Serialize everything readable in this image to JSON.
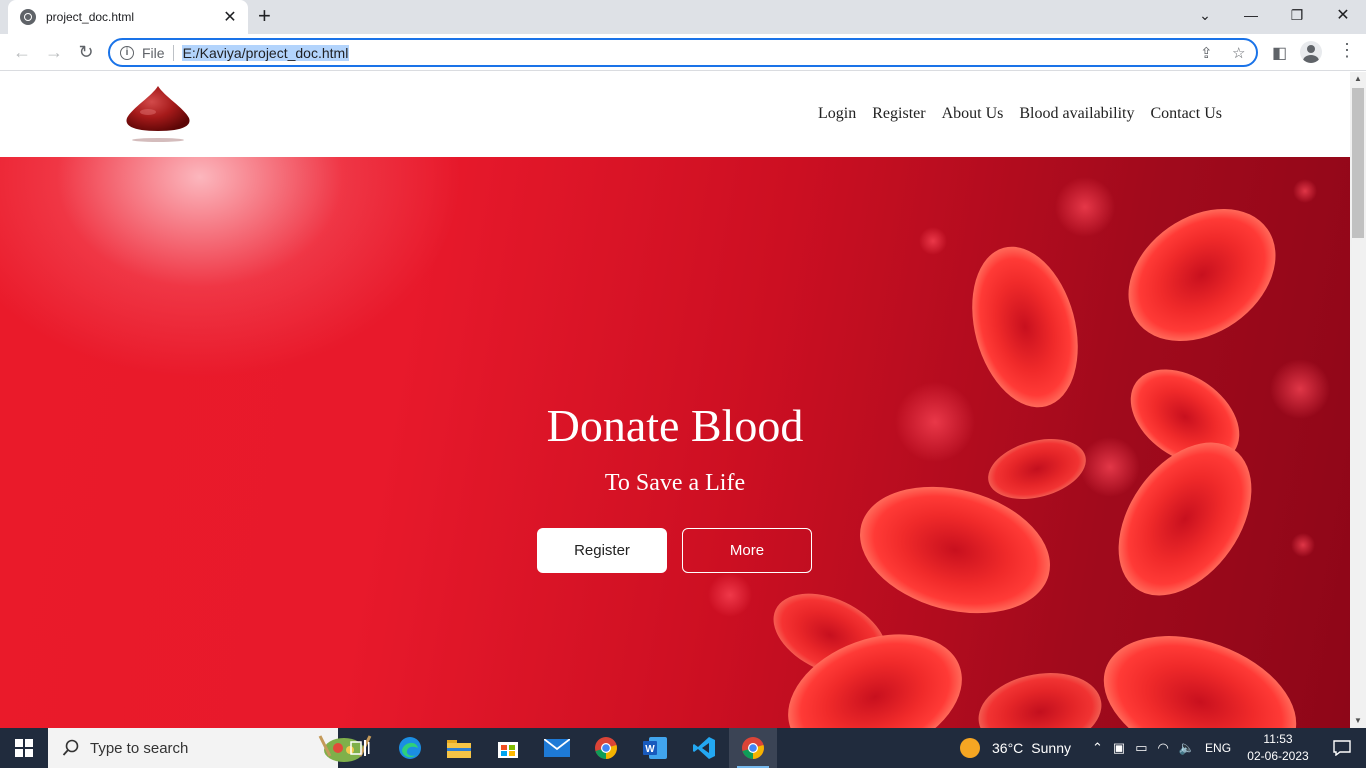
{
  "browser": {
    "tab_title": "project_doc.html",
    "omnibox_scheme_label": "File",
    "url": "E:/Kaviya/project_doc.html"
  },
  "site": {
    "nav": [
      "Login",
      "Register",
      "About Us",
      "Blood availability",
      "Contact Us"
    ],
    "hero": {
      "title": "Donate Blood",
      "subtitle": "To Save a Life",
      "primary_button": "Register",
      "secondary_button": "More"
    }
  },
  "taskbar": {
    "search_placeholder": "Type to search",
    "weather_temp": "36°C",
    "weather_condition": "Sunny",
    "language": "ENG",
    "time": "11:53",
    "date": "02-06-2023"
  },
  "colors": {
    "accent": "#1a73e8",
    "hero_red": "#e8192b",
    "taskbar": "#202b3d"
  }
}
